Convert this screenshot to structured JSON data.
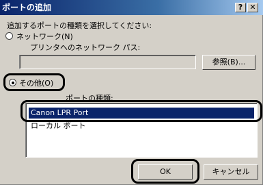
{
  "window": {
    "title": "ポートの追加",
    "help_label": "?",
    "close_label": "✕"
  },
  "prompt": "追加するポートの種類を選択してください:",
  "network": {
    "label": "ネットワーク(N)",
    "path_label": "プリンタへのネットワーク パス:",
    "path_value": "",
    "browse_label": "参照(B)..."
  },
  "other": {
    "label": "その他(O)",
    "port_type_label": "ポートの種類:",
    "ports": [
      "Canon LPR Port",
      "ローカル ポート"
    ],
    "selected_index": 0
  },
  "buttons": {
    "ok": "OK",
    "cancel": "キャンセル"
  },
  "colors": {
    "title_start": "#0a246a",
    "title_end": "#a6caf0",
    "selection": "#0a246a",
    "face": "#d4d0c8"
  }
}
